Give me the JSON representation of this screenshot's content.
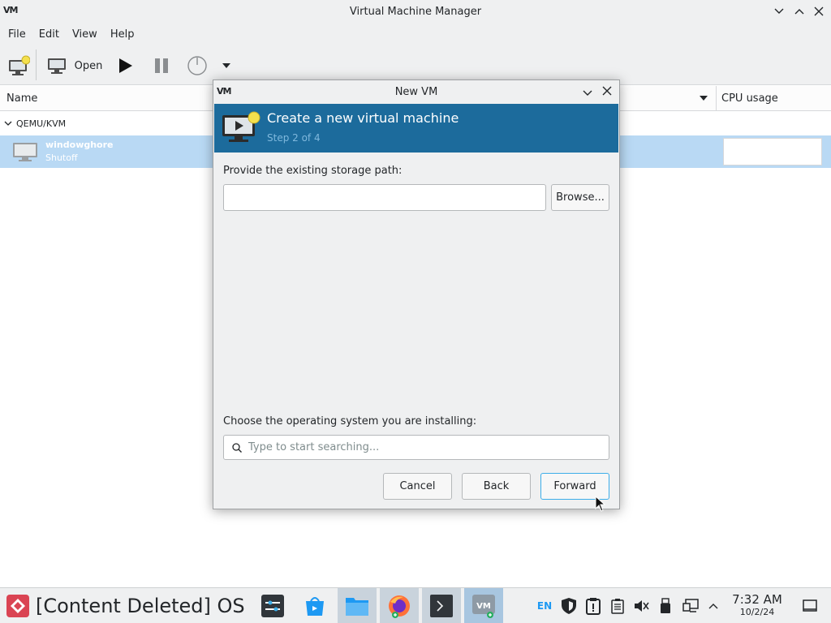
{
  "window": {
    "title": "Virtual Machine Manager",
    "logo_text": "VM"
  },
  "menu": {
    "items": [
      "File",
      "Edit",
      "View",
      "Help"
    ]
  },
  "toolbar": {
    "open_label": "Open"
  },
  "columns": {
    "name": "Name",
    "cpu_usage": "CPU usage"
  },
  "connection": {
    "label": "QEMU/KVM"
  },
  "vm_list": [
    {
      "name": "windowghore",
      "status": "Shutoff"
    }
  ],
  "dialog": {
    "title": "New VM",
    "logo_text": "VM",
    "heading": "Create a new virtual machine",
    "step": "Step 2 of 4",
    "storage_label": "Provide the existing storage path:",
    "storage_value": "",
    "browse_label": "Browse...",
    "os_label": "Choose the operating system you are installing:",
    "os_search_placeholder": "Type to start searching...",
    "cancel_label": "Cancel",
    "back_label": "Back",
    "forward_label": "Forward"
  },
  "taskbar": {
    "start_label": "[Content Deleted] OS",
    "language": "EN",
    "time": "7:32 AM",
    "date": "10/2/24"
  },
  "colors": {
    "banner": "#1c6b9c",
    "selection": "#b9d9f4",
    "accent": "#3daee9",
    "start_red": "#da4453"
  }
}
